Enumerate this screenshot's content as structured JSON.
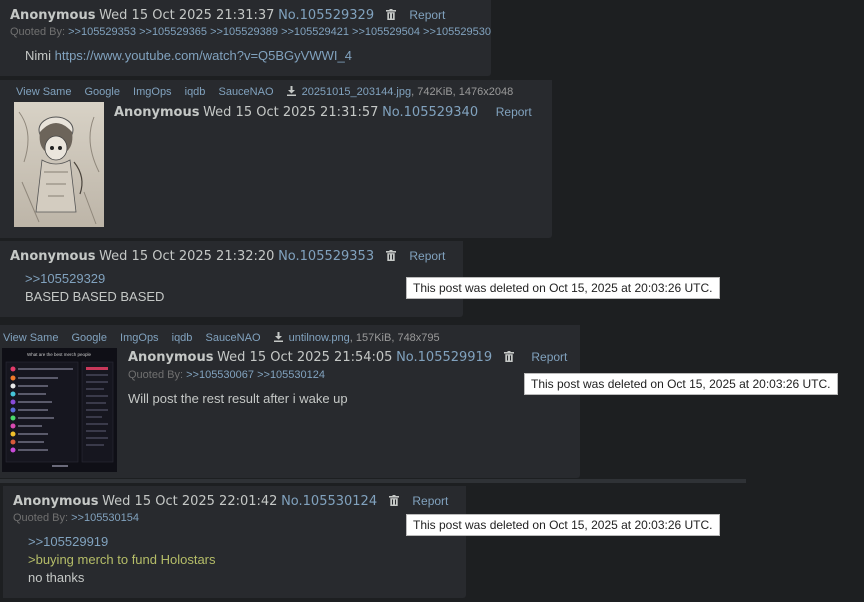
{
  "posts": [
    {
      "name": "Anonymous",
      "date": "Wed 15 Oct 2025 21:31:37",
      "no": "No.105529329",
      "report": "Report",
      "quoted_label": "Quoted By:",
      "quoted": [
        ">>105529353",
        ">>105529365",
        ">>105529389",
        ">>105529421",
        ">>105529504",
        ">>105529530"
      ],
      "body_text": "Nimi",
      "body_link": "https://www.youtube.com/watch?v=Q5BGyVWWI_4"
    },
    {
      "file_tools": [
        "View Same",
        "Google",
        "ImgOps",
        "iqdb",
        "SauceNAO"
      ],
      "file_name": "20251015_203144.jpg",
      "file_info": ", 742KiB, 1476x2048",
      "name": "Anonymous",
      "date": "Wed 15 Oct 2025 21:31:57",
      "no": "No.105529340",
      "report": "Report"
    },
    {
      "name": "Anonymous",
      "date": "Wed 15 Oct 2025 21:32:20",
      "no": "No.105529353",
      "report": "Report",
      "reply_link": ">>105529329",
      "body_text": "BASED BASED BASED",
      "deleted_notice": "This post was deleted on Oct 15, 2025 at 20:03:26 UTC."
    },
    {
      "file_tools": [
        "View Same",
        "Google",
        "ImgOps",
        "iqdb",
        "SauceNAO"
      ],
      "file_name": "untilnow.png",
      "file_info": ", 157KiB, 748x795",
      "thumb_title": "What are the best merch people",
      "name": "Anonymous",
      "date": "Wed 15 Oct 2025 21:54:05",
      "no": "No.105529919",
      "report": "Report",
      "quoted_label": "Quoted By:",
      "quoted": [
        ">>105530067",
        ">>105530124"
      ],
      "body_text": "Will post the rest result after i wake up",
      "deleted_notice": "This post was deleted on Oct 15, 2025 at 20:03:26 UTC."
    },
    {
      "name": "Anonymous",
      "date": "Wed 15 Oct 2025 22:01:42",
      "no": "No.105530124",
      "report": "Report",
      "quoted_label": "Quoted By:",
      "quoted": [
        ">>105530154"
      ],
      "reply_link": ">>105529919",
      "greentext": ">buying merch to fund Holostars",
      "body_text": "no thanks",
      "deleted_notice": "This post was deleted on Oct 15, 2025 at 20:03:26 UTC."
    }
  ],
  "icons": {
    "delete": "trash-icon",
    "download": "download-icon"
  },
  "colors": {
    "link": "#81a2be",
    "greentext": "#b5bd68",
    "post_bg": "#282a2e",
    "page_bg": "#1d1f21"
  }
}
